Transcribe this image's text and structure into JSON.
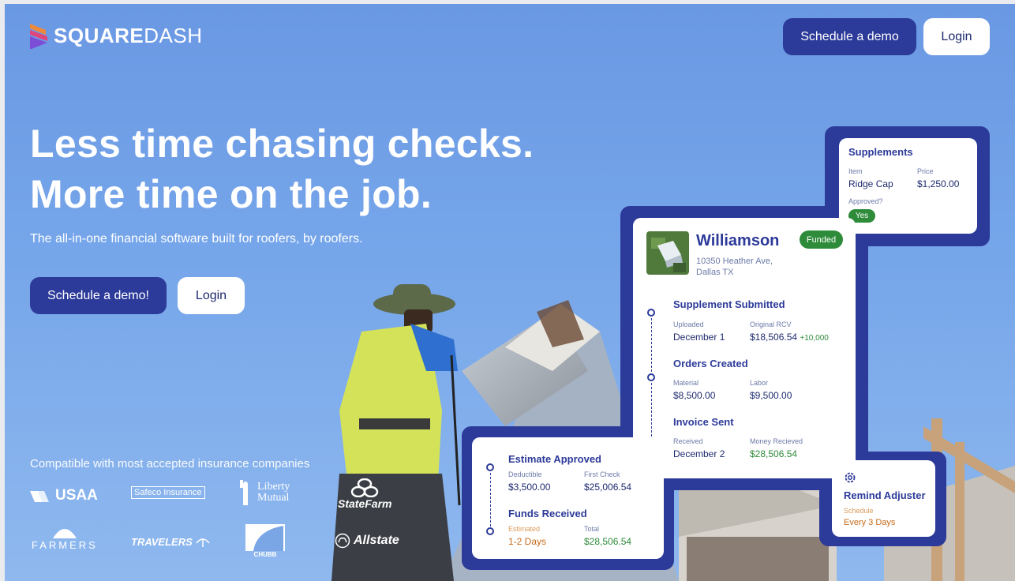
{
  "brand": {
    "name_bold": "SQUARE",
    "name_light": "DASH"
  },
  "nav": {
    "demo_label": "Schedule a demo",
    "login_label": "Login"
  },
  "hero": {
    "headline_1": "Less time chasing checks.",
    "headline_2": "More time on the job.",
    "subheadline": "The all-in-one financial software built for roofers, by roofers.",
    "demo_label": "Schedule a demo!",
    "login_label": "Login"
  },
  "insurance": {
    "heading": "Compatible with most accepted insurance companies",
    "logos": [
      "USAA",
      "Safeco Insurance",
      "Liberty Mutual",
      "StateFarm",
      "FARMERS",
      "TRAVELERS",
      "CHUBB",
      "Allstate"
    ]
  },
  "supplements": {
    "title": "Supplements",
    "item_label": "Item",
    "item_value": "Ridge Cap",
    "price_label": "Price",
    "price_value": "$1,250.00",
    "approved_label": "Approved?",
    "approved_value": "Yes"
  },
  "job": {
    "name": "Williamson",
    "status": "Funded",
    "address_1": "10350 Heather Ave,",
    "address_2": "Dallas TX",
    "steps": [
      {
        "title": "Supplement Submitted",
        "left_label": "Uploaded",
        "left_value": "December 1",
        "right_label": "Original RCV",
        "right_value": "$18,506.54",
        "right_extra": "+10,000"
      },
      {
        "title": "Orders Created",
        "left_label": "Material",
        "left_value": "$8,500.00",
        "right_label": "Labor",
        "right_value": "$9,500.00"
      },
      {
        "title": "Invoice Sent",
        "left_label": "Received",
        "left_value": "December 2",
        "right_label": "Money Recieved",
        "right_value": "$28,506.54"
      }
    ]
  },
  "estimate": {
    "steps": [
      {
        "title": "Estimate Approved",
        "left_label": "Deductible",
        "left_value": "$3,500.00",
        "right_label": "First Check",
        "right_value": "$25,006.54"
      },
      {
        "title": "Funds Received",
        "left_label": "Estimated",
        "left_value": "1-2 Days",
        "right_label": "Total",
        "right_value": "$28,506.54"
      }
    ]
  },
  "adjuster": {
    "title": "Remind Adjuster",
    "schedule_label": "Schedule",
    "schedule_value": "Every 3 Days"
  },
  "colors": {
    "navy": "#2c3a99",
    "green": "#2e8b3a",
    "orange": "#c66a1a",
    "sky": "#6f9fe4"
  }
}
